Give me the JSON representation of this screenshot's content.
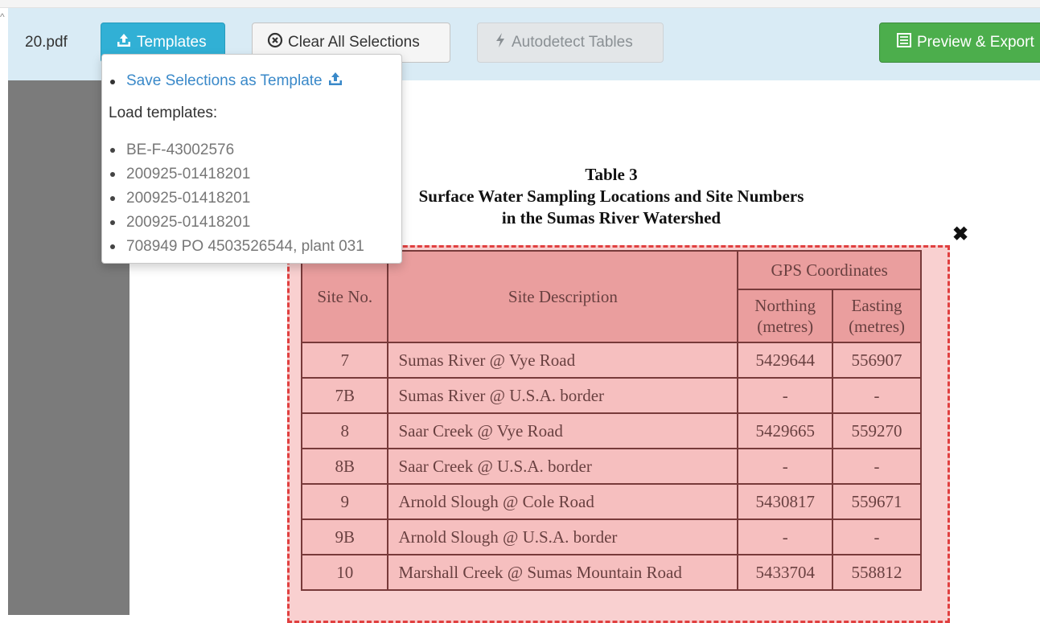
{
  "file": {
    "name": "20.pdf"
  },
  "toolbar": {
    "templates_label": "Templates",
    "clear_label": "Clear All Selections",
    "autodetect_label": "Autodetect Tables",
    "preview_label": "Preview & Export"
  },
  "dropdown": {
    "save_label": "Save Selections as Template",
    "load_heading": "Load templates:",
    "templates": [
      "BE-F-43002576",
      "200925-01418201",
      "200925-01418201",
      "200925-01418201",
      "708949 PO 4503526544, plant 031"
    ]
  },
  "pdf": {
    "title_line1": "Table 3",
    "title_line2": "Surface Water Sampling Locations and Site Numbers",
    "title_line3": "in the Sumas River Watershed",
    "headers": {
      "site": "Site No.",
      "desc": "Site Description",
      "gps": "GPS Coordinates",
      "northing": "Northing (metres)",
      "easting": "Easting (metres)"
    },
    "rows": [
      {
        "site": "7",
        "desc": "Sumas River @ Vye Road",
        "northing": "5429644",
        "easting": "556907"
      },
      {
        "site": "7B",
        "desc": "Sumas River @ U.S.A. border",
        "northing": "-",
        "easting": "-"
      },
      {
        "site": "8",
        "desc": "Saar Creek @ Vye Road",
        "northing": "5429665",
        "easting": "559270"
      },
      {
        "site": "8B",
        "desc": "Saar Creek @ U.S.A. border",
        "northing": "-",
        "easting": "-"
      },
      {
        "site": "9",
        "desc": "Arnold Slough @ Cole Road",
        "northing": "5430817",
        "easting": "559671"
      },
      {
        "site": "9B",
        "desc": "Arnold Slough @ U.S.A. border",
        "northing": "-",
        "easting": "-"
      },
      {
        "site": "10",
        "desc": "Marshall Creek @ Sumas Mountain Road",
        "northing": "5433704",
        "easting": "558812"
      }
    ]
  },
  "colors": {
    "toolbar_bg": "#d9ebf5",
    "templates_btn": "#31b0d5",
    "export_btn": "#4cae4c",
    "selection_border": "#e04040",
    "link": "#3a89c9"
  },
  "icons": {
    "templates": "upload-tray-icon",
    "clear": "circle-x-icon",
    "autodetect": "bolt-icon",
    "preview": "table-list-icon",
    "close": "close-icon"
  }
}
